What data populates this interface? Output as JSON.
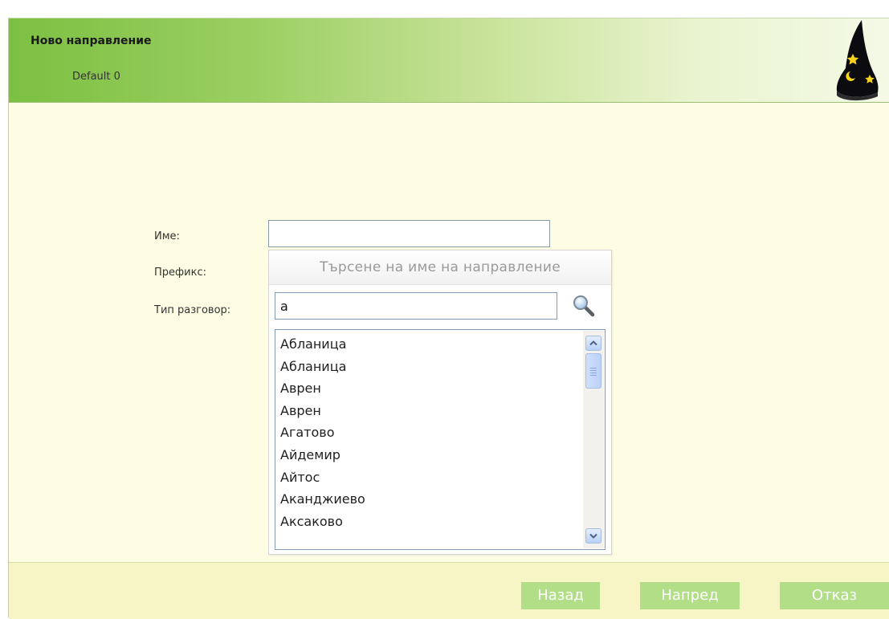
{
  "header": {
    "title": "Ново направление",
    "subtitle": "Default 0",
    "logo_icon": "wizard-hat-icon"
  },
  "form": {
    "name_label": "Име:",
    "prefix_label": "Префикс:",
    "call_type_label": "Тип разговор:",
    "name_value": ""
  },
  "search_popup": {
    "title": "Търсене на име на направление",
    "search_value": "а",
    "search_icon": "magnifier-icon",
    "results": [
      "Абланица",
      "Абланица",
      "Аврен",
      "Аврен",
      "Агатово",
      "Айдемир",
      "Айтос",
      "Аканджиево",
      "Аксаково"
    ]
  },
  "footer": {
    "back_label": "Назад",
    "next_label": "Напред",
    "cancel_label": "Отказ"
  },
  "colors": {
    "header_green": "#7cc042",
    "background": "#fdfde3",
    "footer": "#f7f5c6",
    "button": "#b3de88"
  }
}
